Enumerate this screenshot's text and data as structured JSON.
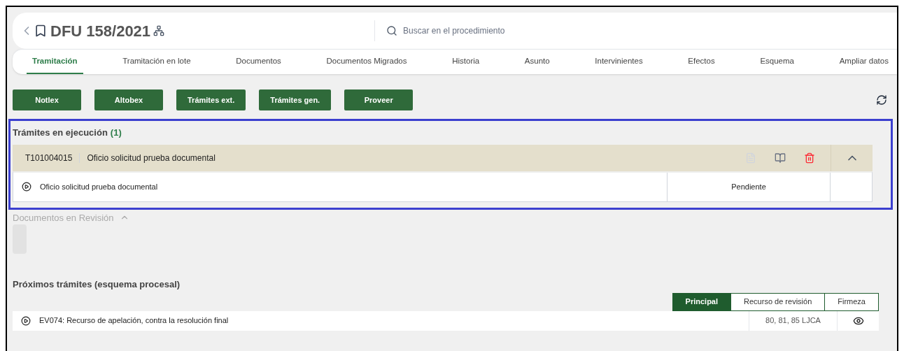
{
  "header": {
    "title": "DFU 158/2021",
    "search": {
      "placeholder": "Buscar en el procedimiento"
    }
  },
  "tabs": [
    {
      "label": "Tramitación",
      "selected": true
    },
    {
      "label": "Tramitación en lote",
      "selected": false
    },
    {
      "label": "Documentos",
      "selected": false
    },
    {
      "label": "Documentos Migrados",
      "selected": false
    },
    {
      "label": "Historia",
      "selected": false
    },
    {
      "label": "Asunto",
      "selected": false
    },
    {
      "label": "Intervinientes",
      "selected": false
    },
    {
      "label": "Efectos",
      "selected": false
    },
    {
      "label": "Esquema",
      "selected": false
    },
    {
      "label": "Ampliar datos",
      "selected": false
    }
  ],
  "actions": [
    "Notlex",
    "Altobex",
    "Trámites ext.",
    "Trámites gen.",
    "Proveer"
  ],
  "en_ejecucion": {
    "title": "Trámites en ejecución",
    "count": "(1)",
    "expanded": true,
    "tramite": {
      "code": "T101004015",
      "name": "Oficio solicitud prueba documental"
    },
    "rows": [
      {
        "name": "Oficio solicitud prueba documental",
        "status": "Pendiente"
      }
    ]
  },
  "revision": {
    "title": "Documentos en Revisión",
    "expanded": true
  },
  "proximos": {
    "title": "Próximos trámites (esquema procesal)",
    "tabs": [
      {
        "label": "Principal",
        "selected": true
      },
      {
        "label": "Recurso de revisión",
        "selected": false
      },
      {
        "label": "Firmeza",
        "selected": false
      }
    ],
    "rows": [
      {
        "name": "EV074: Recurso de apelación, contra la resolución final",
        "reference": "80, 81, 85 LJCA"
      }
    ]
  }
}
